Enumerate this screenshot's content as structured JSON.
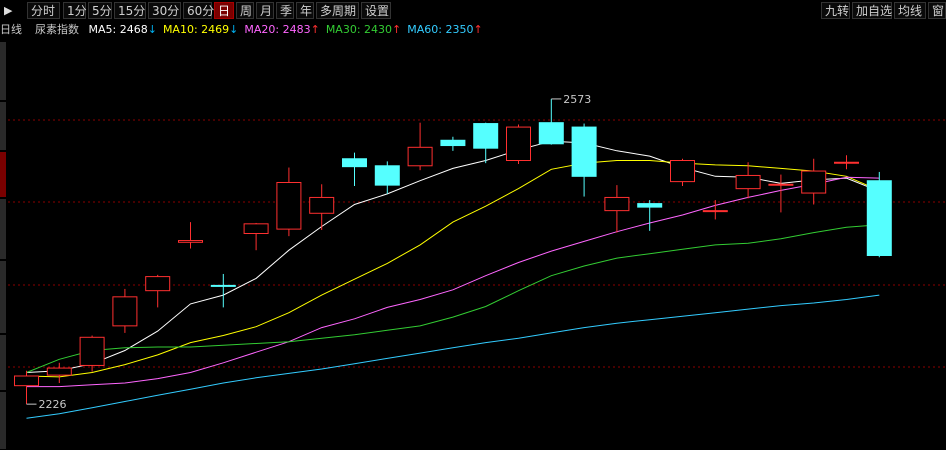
{
  "toolbar": {
    "arrow_label": "▶",
    "tabs": [
      {
        "label": "分时",
        "active": false
      },
      {
        "label": "1分",
        "active": false
      },
      {
        "label": "5分",
        "active": false
      },
      {
        "label": "15分",
        "active": false
      },
      {
        "label": "30分",
        "active": false
      },
      {
        "label": "60分",
        "active": false
      },
      {
        "label": "日",
        "active": true
      },
      {
        "label": "周",
        "active": false
      },
      {
        "label": "月",
        "active": false
      },
      {
        "label": "季",
        "active": false
      },
      {
        "label": "年",
        "active": false
      },
      {
        "label": "多周期",
        "active": false
      },
      {
        "label": "设置",
        "active": false
      }
    ],
    "right_buttons": [
      "九转",
      "加自选",
      "均线",
      "窗"
    ]
  },
  "legend": {
    "period": "日线",
    "symbol": "尿素指数",
    "ma": [
      {
        "label": "MA5: 2468",
        "arrow": "↓",
        "color": "#ffffff",
        "arrow_color": "#00b0f0"
      },
      {
        "label": "MA10: 2469",
        "arrow": "↓",
        "color": "#ffff00",
        "arrow_color": "#00b0f0"
      },
      {
        "label": "MA20: 2483",
        "arrow": "↑",
        "color": "#ff66ff",
        "arrow_color": "#ff3030"
      },
      {
        "label": "MA30: 2430",
        "arrow": "↑",
        "color": "#33cc33",
        "arrow_color": "#ff3030"
      },
      {
        "label": "MA60: 2350",
        "arrow": "↑",
        "color": "#33ccff",
        "arrow_color": "#ff3030"
      }
    ]
  },
  "colors": {
    "up": "#ff3030",
    "down": "#55ffff",
    "grid": "#8b0000",
    "ma5": "#ffffff",
    "ma10": "#ffff00",
    "ma20": "#ff66ff",
    "ma30": "#33cc33",
    "ma60": "#33ccff"
  },
  "chart_data": {
    "type": "candlestick",
    "title": "尿素指数",
    "period": "日线",
    "ylim": [
      2175,
      2640
    ],
    "grid": true,
    "annotations": {
      "high": "2573",
      "low": "2226"
    },
    "candles": [
      {
        "o": 2247,
        "h": 2264,
        "l": 2226,
        "c": 2258
      },
      {
        "o": 2259,
        "h": 2273,
        "l": 2250,
        "c": 2267
      },
      {
        "o": 2270,
        "h": 2304,
        "l": 2263,
        "c": 2302
      },
      {
        "o": 2315,
        "h": 2357,
        "l": 2307,
        "c": 2348
      },
      {
        "o": 2355,
        "h": 2373,
        "l": 2336,
        "c": 2371
      },
      {
        "o": 2410,
        "h": 2433,
        "l": 2403,
        "c": 2412
      },
      {
        "o": 2361,
        "h": 2374,
        "l": 2336,
        "c": 2360
      },
      {
        "o": 2420,
        "h": 2432,
        "l": 2401,
        "c": 2431
      },
      {
        "o": 2425,
        "h": 2495,
        "l": 2417,
        "c": 2478
      },
      {
        "o": 2443,
        "h": 2476,
        "l": 2424,
        "c": 2461
      },
      {
        "o": 2505,
        "h": 2512,
        "l": 2474,
        "c": 2496
      },
      {
        "o": 2497,
        "h": 2502,
        "l": 2465,
        "c": 2475
      },
      {
        "o": 2497,
        "h": 2546,
        "l": 2492,
        "c": 2518
      },
      {
        "o": 2526,
        "h": 2530,
        "l": 2514,
        "c": 2520
      },
      {
        "o": 2545,
        "h": 2546,
        "l": 2500,
        "c": 2517
      },
      {
        "o": 2503,
        "h": 2544,
        "l": 2499,
        "c": 2541
      },
      {
        "o": 2546,
        "h": 2573,
        "l": 2521,
        "c": 2522
      },
      {
        "o": 2541,
        "h": 2545,
        "l": 2462,
        "c": 2485
      },
      {
        "o": 2446,
        "h": 2475,
        "l": 2421,
        "c": 2461
      },
      {
        "o": 2454,
        "h": 2458,
        "l": 2423,
        "c": 2450
      },
      {
        "o": 2479,
        "h": 2505,
        "l": 2474,
        "c": 2503
      },
      {
        "o": 2446,
        "h": 2458,
        "l": 2436,
        "c": 2446
      },
      {
        "o": 2471,
        "h": 2501,
        "l": 2460,
        "c": 2486
      },
      {
        "o": 2475,
        "h": 2487,
        "l": 2444,
        "c": 2476
      },
      {
        "o": 2466,
        "h": 2505,
        "l": 2453,
        "c": 2491
      },
      {
        "o": 2501,
        "h": 2509,
        "l": 2493,
        "c": 2501
      },
      {
        "o": 2480,
        "h": 2490,
        "l": 2393,
        "c": 2395
      }
    ],
    "series": [
      {
        "name": "MA5",
        "values": [
          2262,
          2264,
          2272,
          2287,
          2309,
          2340,
          2350,
          2369,
          2401,
          2428,
          2453,
          2465,
          2480,
          2494,
          2503,
          2515,
          2525,
          2523,
          2514,
          2508,
          2495,
          2485,
          2484,
          2477,
          2481,
          2483,
          2468
        ]
      },
      {
        "name": "MA10",
        "values": [
          2258,
          2257,
          2262,
          2271,
          2282,
          2296,
          2304,
          2314,
          2330,
          2350,
          2368,
          2386,
          2407,
          2433,
          2451,
          2471,
          2493,
          2500,
          2503,
          2503,
          2500,
          2498,
          2497,
          2494,
          2491,
          2485,
          2469
        ]
      },
      {
        "name": "MA20",
        "values": [
          2246,
          2246,
          2248,
          2250,
          2255,
          2262,
          2273,
          2285,
          2297,
          2313,
          2323,
          2336,
          2345,
          2356,
          2372,
          2387,
          2400,
          2411,
          2422,
          2432,
          2441,
          2452,
          2461,
          2469,
          2476,
          2484,
          2483
        ]
      },
      {
        "name": "MA30",
        "values": [
          2262,
          2277,
          2287,
          2290,
          2291,
          2291,
          2293,
          2295,
          2297,
          2301,
          2305,
          2310,
          2315,
          2325,
          2337,
          2355,
          2372,
          2383,
          2392,
          2397,
          2402,
          2407,
          2409,
          2414,
          2421,
          2427,
          2430
        ]
      },
      {
        "name": "MA60",
        "values": [
          2210,
          2215,
          2222,
          2229,
          2236,
          2243,
          2250,
          2256,
          2261,
          2266,
          2272,
          2278,
          2284,
          2290,
          2296,
          2301,
          2307,
          2313,
          2318,
          2322,
          2326,
          2330,
          2334,
          2338,
          2341,
          2345,
          2350
        ]
      }
    ]
  }
}
